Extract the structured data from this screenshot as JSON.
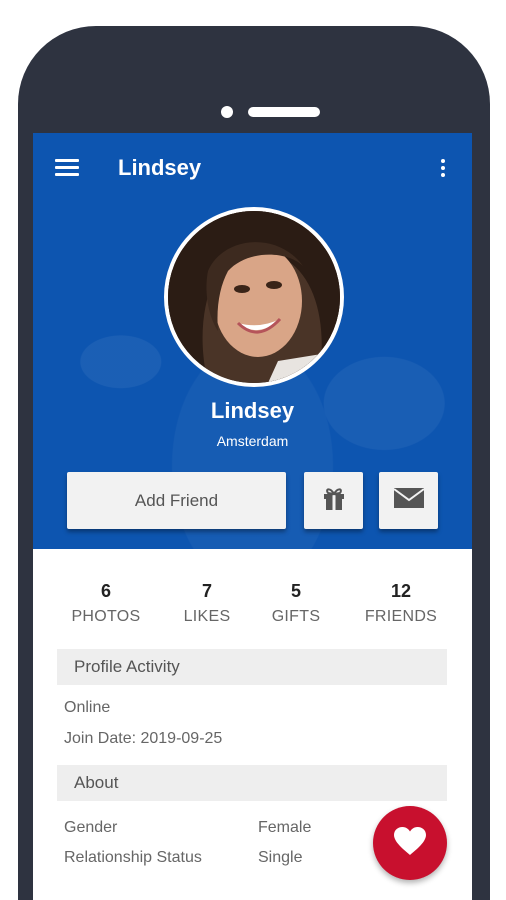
{
  "app_bar": {
    "title": "Lindsey",
    "menu_icon": "hamburger-menu-icon",
    "more_icon": "more-vert-icon"
  },
  "profile": {
    "name": "Lindsey",
    "location": "Amsterdam"
  },
  "actions": {
    "add_friend_label": "Add Friend",
    "gift_icon": "gift-icon",
    "message_icon": "envelope-icon"
  },
  "stats": [
    {
      "value": "6",
      "label": "PHOTOS"
    },
    {
      "value": "7",
      "label": "LIKES"
    },
    {
      "value": "5",
      "label": "GIFTS"
    },
    {
      "value": "12",
      "label": "FRIENDS"
    }
  ],
  "profile_activity": {
    "header": "Profile Activity",
    "status": "Online",
    "join_date": "Join Date: 2019-09-25"
  },
  "about": {
    "header": "About",
    "rows": [
      {
        "label": "Gender",
        "value": "Female"
      },
      {
        "label": "Relationship Status",
        "value": "Single"
      }
    ]
  },
  "fab": {
    "icon": "heart-icon"
  },
  "colors": {
    "primary": "#0d55b0",
    "accent": "#c8102e",
    "device_frame": "#2e3340"
  }
}
